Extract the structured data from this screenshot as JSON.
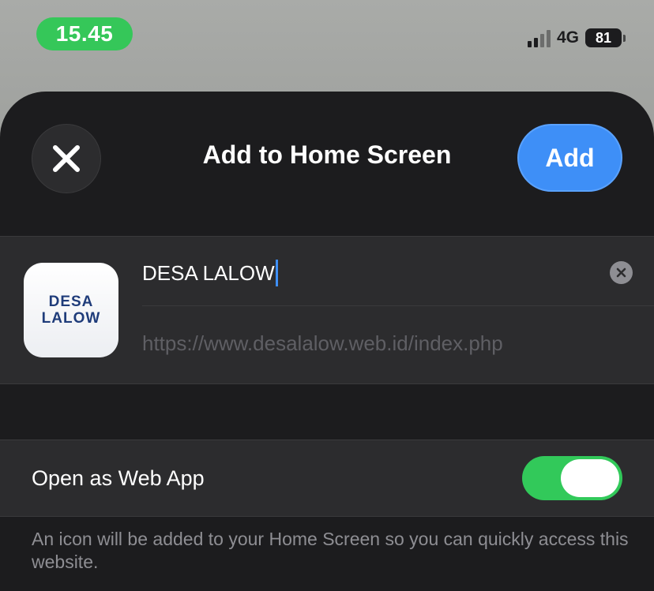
{
  "status_bar": {
    "time": "15.45",
    "network": "4G",
    "battery": "81"
  },
  "sheet": {
    "title": "Add to Home Screen",
    "add_label": "Add"
  },
  "bookmark": {
    "icon_line1": "DESA",
    "icon_line2": "LALOW",
    "name": "DESA LALOW",
    "url": "https://www.desalalow.web.id/index.php"
  },
  "web_app_option": {
    "label": "Open as Web App",
    "enabled": true,
    "description": "An icon will be added to your Home Screen so you can quickly access this website."
  },
  "colors": {
    "accent": "#3e8ff7",
    "toggle_on": "#32c95a",
    "time_pill": "#35c759",
    "sheet_bg": "#1c1c1e",
    "card_bg": "#2c2c2e"
  }
}
